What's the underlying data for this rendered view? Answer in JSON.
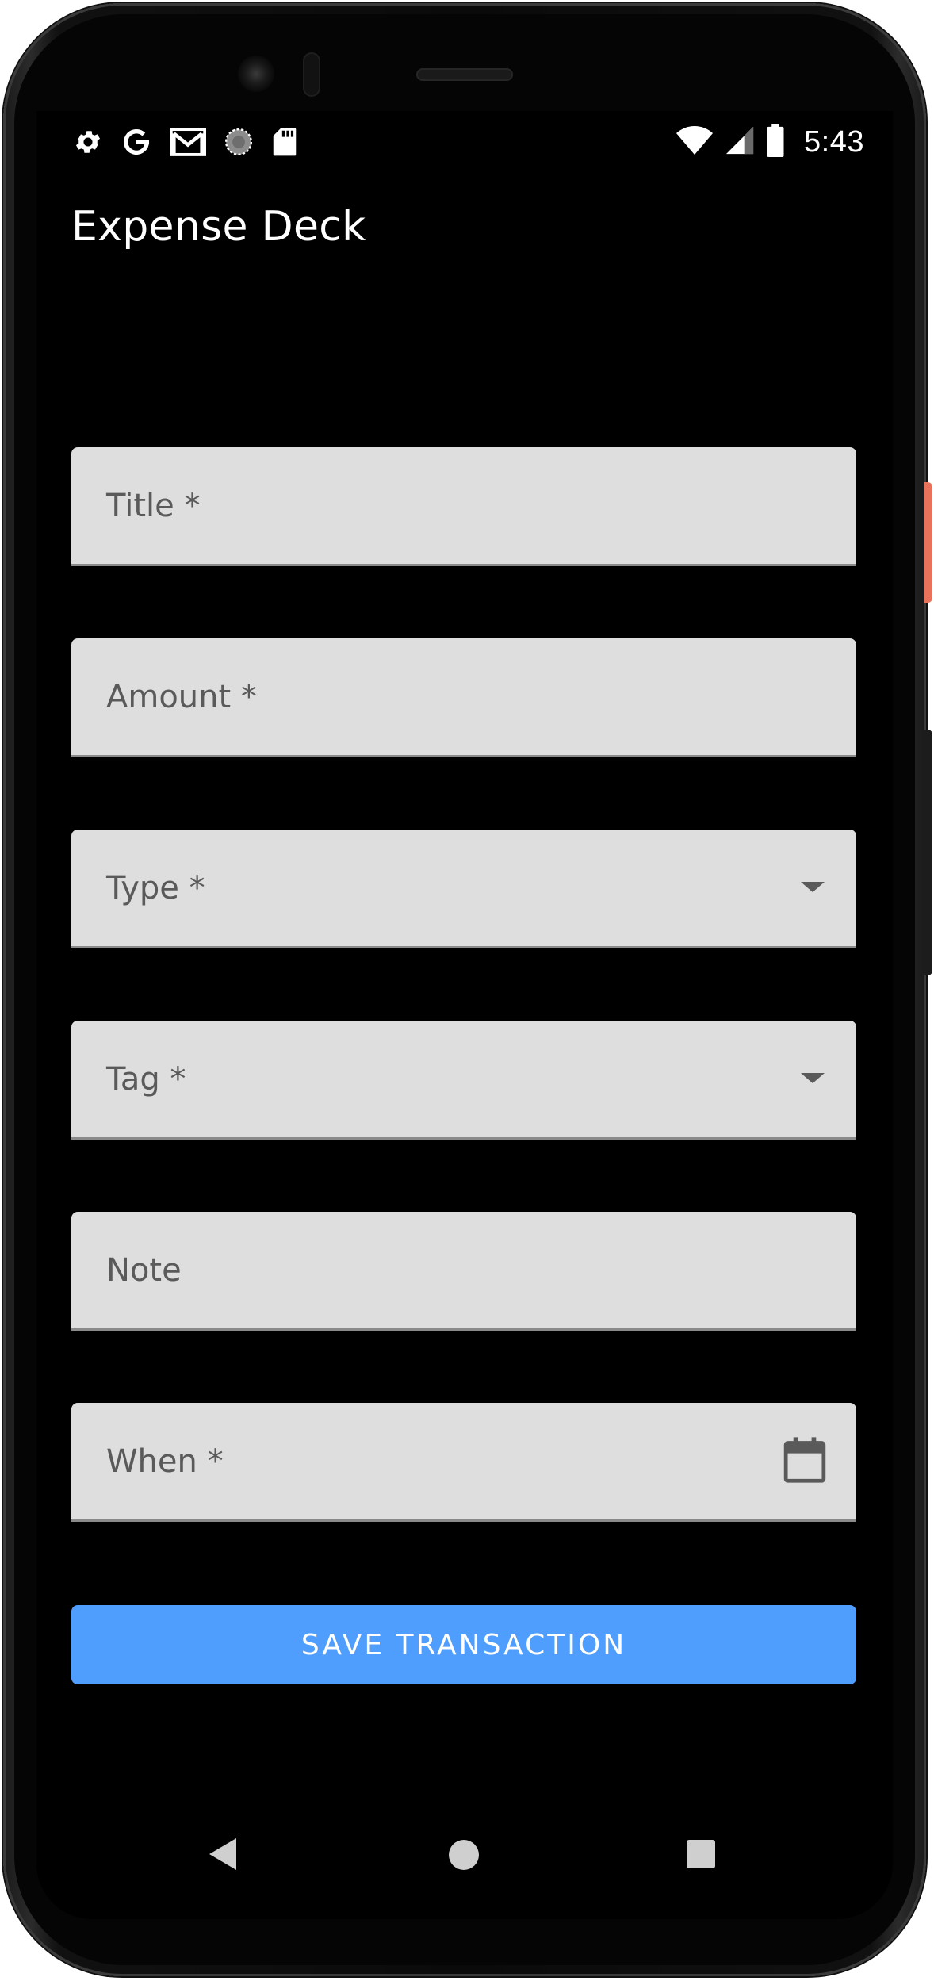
{
  "status_bar": {
    "time": "5:43",
    "left_icons": [
      "gear-icon",
      "google-g-icon",
      "gmail-icon",
      "sync-progress-icon",
      "sd-card-icon"
    ],
    "right_icons": [
      "wifi-icon",
      "signal-icon",
      "battery-icon"
    ]
  },
  "app_bar": {
    "title": "Expense Deck"
  },
  "form": {
    "fields": [
      {
        "label": "Title *",
        "type": "text",
        "value": ""
      },
      {
        "label": "Amount *",
        "type": "number",
        "value": ""
      },
      {
        "label": "Type *",
        "type": "select",
        "value": "",
        "icon": "dropdown-arrow-icon"
      },
      {
        "label": "Tag *",
        "type": "select",
        "value": "",
        "icon": "dropdown-arrow-icon"
      },
      {
        "label": "Note",
        "type": "text",
        "value": ""
      },
      {
        "label": "When *",
        "type": "date",
        "value": "",
        "icon": "calendar-icon"
      }
    ],
    "save_label": "SAVE TRANSACTION"
  },
  "nav_bar": {
    "buttons": [
      "back-icon",
      "home-icon",
      "recents-icon"
    ]
  },
  "colors": {
    "background": "#000000",
    "field_background": "#dedede",
    "field_label": "#5a5a5a",
    "accent_button": "#4f9dfc",
    "text_on_dark": "#ffffff"
  }
}
